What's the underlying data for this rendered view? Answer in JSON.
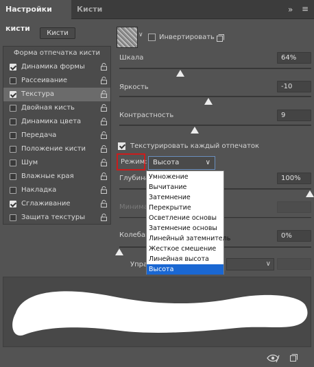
{
  "tabs": [
    {
      "label": "Настройки кисти"
    },
    {
      "label": "Кисти"
    }
  ],
  "brushes_button": "Кисти",
  "left_list": {
    "header": "Форма отпечатка кисти",
    "items": [
      {
        "label": "Динамика формы",
        "checked": true
      },
      {
        "label": "Рассеивание",
        "checked": false
      },
      {
        "label": "Текстура",
        "checked": true,
        "selected": true
      },
      {
        "label": "Двойная кисть",
        "checked": false
      },
      {
        "label": "Динамика цвета",
        "checked": false
      },
      {
        "label": "Передача",
        "checked": false
      },
      {
        "label": "Положение кисти",
        "checked": false
      },
      {
        "label": "Шум",
        "checked": false
      },
      {
        "label": "Влажные края",
        "checked": false
      },
      {
        "label": "Накладка",
        "checked": false
      },
      {
        "label": "Сглаживание",
        "checked": true
      },
      {
        "label": "Защита текстуры",
        "checked": false
      }
    ]
  },
  "texture": {
    "invert_label": "Инвертировать",
    "scale": {
      "label": "Шкала",
      "value": "64%"
    },
    "brightness": {
      "label": "Яркость",
      "value": "-10"
    },
    "contrast": {
      "label": "Контрастность",
      "value": "9"
    },
    "each_tip_label": "Текстурировать каждый отпечаток",
    "mode_label": "Режим:",
    "mode_value": "Высота",
    "depth_label": "Глубина",
    "depth_value": "100%",
    "min_depth_label": "Минима",
    "jitter_label": "Колебани",
    "jitter_value": "0%",
    "control_label": "Управ"
  },
  "mode_options": [
    "Умножение",
    "Вычитание",
    "Затемнение",
    "Перекрытие",
    "Осветление основы",
    "Затемнение основы",
    "Линейный затемнитель",
    "Жесткое смешение",
    "Линейная высота",
    "Высота"
  ],
  "mode_selected_index": 9,
  "colors": {
    "panel_bg": "#535353",
    "accent_select": "#1a67d2",
    "highlight_box": "#cc1c1c"
  }
}
